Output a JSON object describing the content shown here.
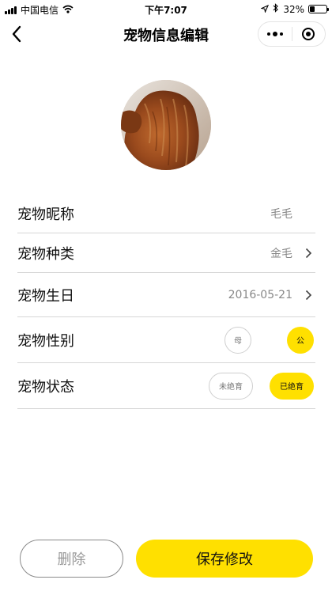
{
  "status_bar": {
    "carrier": "中国电信",
    "time": "下午7:07",
    "battery": "32%",
    "battery_level": 0.32,
    "icons": [
      "signal-icon",
      "wifi-icon",
      "location-arrow-icon",
      "bluetooth-icon",
      "battery-icon"
    ]
  },
  "nav": {
    "title": "宠物信息编辑",
    "icons": [
      "back-arrow-icon",
      "more-dots-icon",
      "close-target-icon"
    ]
  },
  "form": {
    "nickname": {
      "label": "宠物昵称",
      "value": "毛毛"
    },
    "breed": {
      "label": "宠物种类",
      "value": "金毛"
    },
    "birthday": {
      "label": "宠物生日",
      "value": "2016-05-21"
    },
    "gender": {
      "label": "宠物性别",
      "options": [
        "母",
        "公"
      ],
      "selected": "公"
    },
    "status": {
      "label": "宠物状态",
      "options": [
        "未绝育",
        "已绝育"
      ],
      "selected": "已绝育"
    }
  },
  "actions": {
    "delete_label": "删除",
    "save_label": "保存修改"
  },
  "colors": {
    "accent": "#ffe000",
    "divider": "#d6d6d6",
    "muted_text": "#888888"
  }
}
